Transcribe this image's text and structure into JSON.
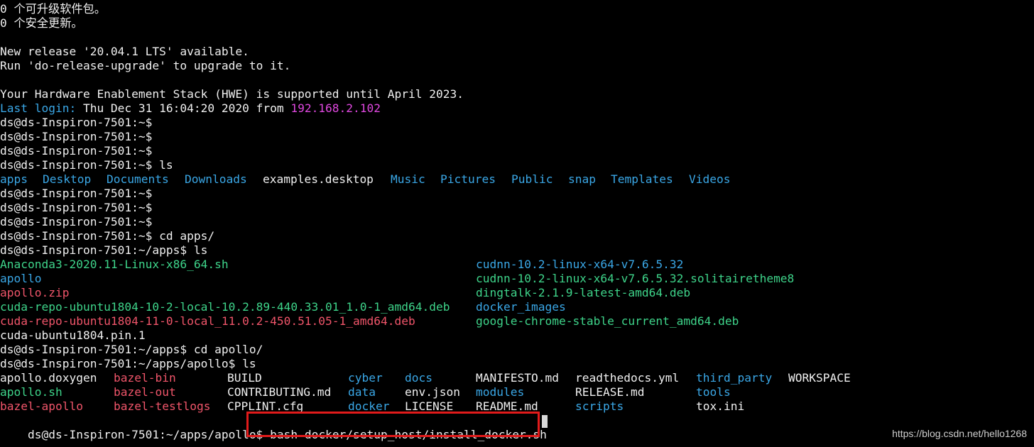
{
  "motd": {
    "upgradable": "0 个可升级软件包。",
    "security": "0 个安全更新。",
    "new_release": "New release '20.04.1 LTS' available.",
    "run_upgrade": "Run 'do-release-upgrade' to upgrade to it.",
    "hwe": "Your Hardware Enablement Stack (HWE) is supported until April 2023.",
    "last_login_label": "Last login:",
    "last_login_time": " Thu Dec 31 16:04:20 2020 from ",
    "last_login_ip": "192.168.2.102"
  },
  "prompts": {
    "home": "ds@ds-Inspiron-7501:~$",
    "home_ls": "ds@ds-Inspiron-7501:~$ ls",
    "home_cd": "ds@ds-Inspiron-7501:~$ cd apps/",
    "apps_ls": "ds@ds-Inspiron-7501:~/apps$ ls",
    "apps_cd": "ds@ds-Inspiron-7501:~/apps$ cd apollo/",
    "apollo_ls": "ds@ds-Inspiron-7501:~/apps/apollo$ ls",
    "apollo": "ds@ds-Inspiron-7501:~/apps/apollo$ "
  },
  "home_listing": {
    "apps": "apps",
    "desktop": "Desktop",
    "documents": "Documents",
    "downloads": "Downloads",
    "examples": "examples.desktop",
    "music": "Music",
    "pictures": "Pictures",
    "public": "Public",
    "snap": "snap",
    "templates": "Templates",
    "videos": "Videos"
  },
  "apps_listing": {
    "anaconda": "Anaconda3-2020.11-Linux-x86_64.sh",
    "apollo": "apollo",
    "apollo_zip": "apollo.zip",
    "cuda_repo_10": "cuda-repo-ubuntu1804-10-2-local-10.2.89-440.33.01_1.0-1_amd64.deb",
    "cuda_repo_11": "cuda-repo-ubuntu1804-11-0-local_11.0.2-450.51.05-1_amd64.deb",
    "cuda_pin": "cuda-ubuntu1804.pin.1",
    "cudnn": "cudnn-10.2-linux-x64-v7.6.5.32",
    "cudnn_theme": "cudnn-10.2-linux-x64-v7.6.5.32.solitairetheme8",
    "dingtalk": "dingtalk-2.1.9-latest-amd64.deb",
    "docker_images": "docker_images",
    "chrome": "google-chrome-stable_current_amd64.deb"
  },
  "apollo_listing": {
    "apollo_doxygen": "apollo.doxygen",
    "apollo_sh": "apollo.sh",
    "bazel_apollo": "bazel-apollo",
    "bazel_bin": "bazel-bin",
    "bazel_out": "bazel-out",
    "bazel_testlogs": "bazel-testlogs",
    "build": "BUILD",
    "contributing": "CONTRIBUTING.md",
    "cpplint": "CPPLINT.cfg",
    "cyber": "cyber",
    "data": "data",
    "docker": "docker",
    "docs": "docs",
    "env_json": "env.json",
    "license": "LICENSE",
    "manifesto": "MANIFESTO.md",
    "modules": "modules",
    "readme": "README.md",
    "readthedocs": "readthedocs.yml",
    "release": "RELEASE.md",
    "scripts": "scripts",
    "third_party": "third_party",
    "tools": "tools",
    "tox_ini": "tox.ini",
    "workspace": "WORKSPACE"
  },
  "current_command": "bash docker/setup_host/install_docker.sh",
  "watermark": "https://blog.csdn.net/hello1268",
  "colors": {
    "background": "#000000",
    "text": "#f0f0f0",
    "directory": "#3aa7e6",
    "executable": "#3ed48a",
    "archive": "#f0556a",
    "ip": "#e048e0",
    "highlight_box": "#e11b1b"
  }
}
